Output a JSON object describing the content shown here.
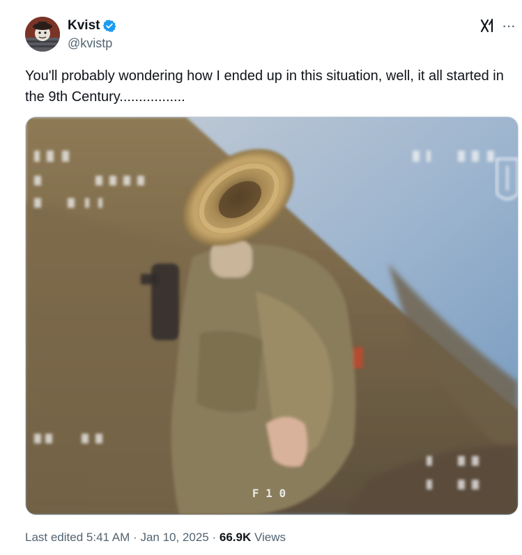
{
  "author": {
    "display_name": "Kvist",
    "handle": "@kvistp",
    "verified": true,
    "verified_color": "#1d9bf0"
  },
  "tweet": {
    "text": "You'll probably wondering how I ended up in this situation, well, it all started in the 9th Century................."
  },
  "media": {
    "overlay_text": "F 1 0"
  },
  "meta": {
    "edited_label": "Last edited",
    "time": "5:41 AM",
    "separator": "·",
    "date": "Jan 10, 2025",
    "views_count": "66.9K",
    "views_label": "Views"
  },
  "icons": {
    "grok": "grok-icon",
    "more": "more-icon",
    "verified": "verified-badge-icon"
  }
}
